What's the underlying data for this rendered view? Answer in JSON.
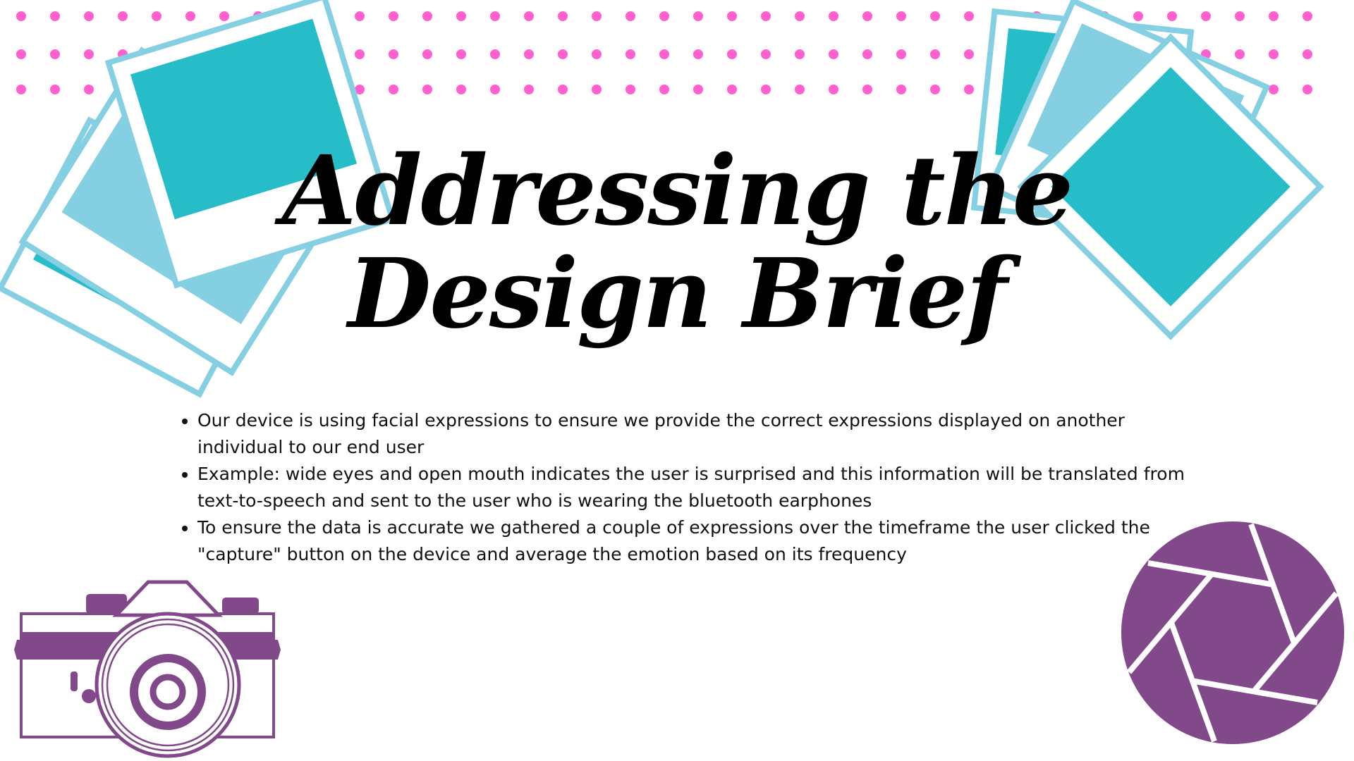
{
  "slide": {
    "title": "Addressing the Design Brief",
    "bullets": [
      "Our device is using facial expressions to ensure we provide the correct expressions displayed on another individual to our end user",
      "Example: wide eyes and open mouth indicates the user is surprised and this information will be translated from text-to-speech and sent to the user who is wearing the bluetooth earphones",
      "To ensure the data is accurate we gathered a couple of expressions over the timeframe the user clicked the \"capture\" button on the device and average the emotion based on its frequency"
    ]
  },
  "decorations": {
    "dot_pattern": "pink-polka-dots",
    "left_graphic": "polaroid-stack-icon",
    "right_graphic": "polaroid-stack-icon",
    "bottom_left_graphic": "camera-icon",
    "bottom_right_graphic": "aperture-icon"
  },
  "colors": {
    "dots": "#ff5fcf",
    "photo_frame": "#85cfe3",
    "photo_fill": "#26bdc9",
    "photo_fill_light": "#85cfe3",
    "purple": "#81488a",
    "title": "#000000",
    "text": "#111111"
  }
}
